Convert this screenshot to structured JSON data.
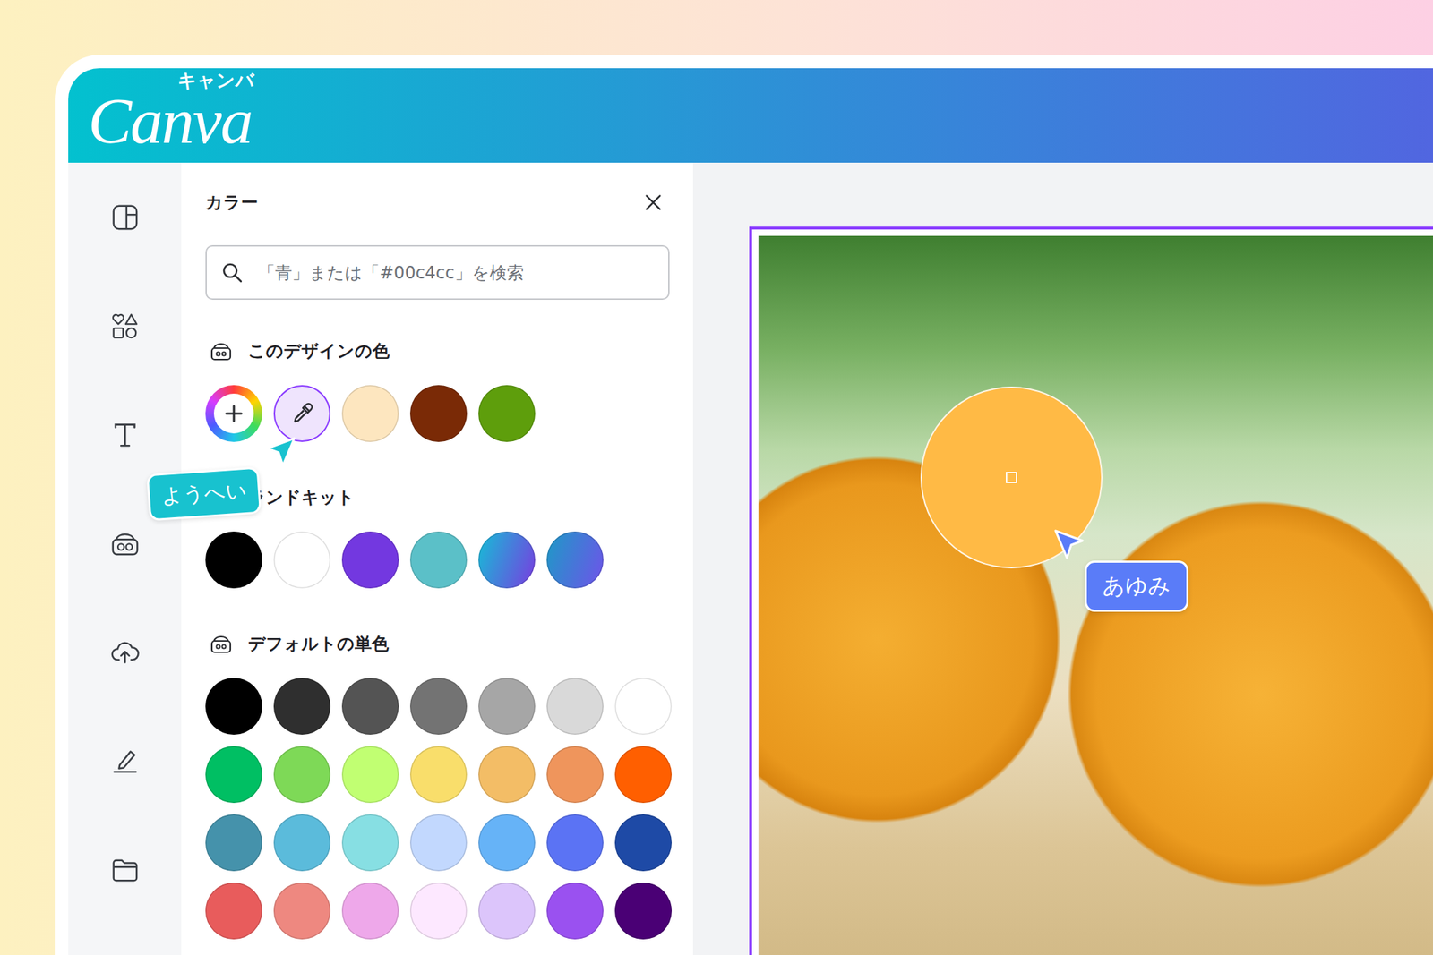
{
  "app": {
    "logo": "Canva",
    "logo_kana": "キャンバ"
  },
  "panel": {
    "title": "カラー"
  },
  "search": {
    "placeholder": "「青」または「#00c4cc」を検索"
  },
  "sections": [
    {
      "title": "このデザインの色",
      "swatches": [
        {
          "kind": "add",
          "selected": false
        },
        {
          "kind": "eyedropper",
          "selected": true
        },
        {
          "kind": "color",
          "color": "#fde6bf",
          "selected": false
        },
        {
          "kind": "color",
          "color": "#7a2a06",
          "selected": false
        },
        {
          "kind": "color",
          "color": "#5e9e0c",
          "selected": false
        }
      ]
    },
    {
      "title": "ランドキット",
      "swatches": [
        {
          "kind": "color",
          "color": "#000000",
          "selected": false
        },
        {
          "kind": "color",
          "color": "#ffffff",
          "selected": false
        },
        {
          "kind": "color",
          "color": "#7338e0",
          "selected": false
        },
        {
          "kind": "color",
          "color": "#5bc0c8",
          "selected": false
        },
        {
          "kind": "gradient",
          "color": "#14bfd6",
          "color_end": "#7a3be0",
          "selected": false
        },
        {
          "kind": "gradient",
          "color": "#1c9bc6",
          "color_end": "#7052ea",
          "selected": false
        }
      ]
    },
    {
      "title": "デフォルトの単色",
      "swatches": [
        {
          "kind": "color",
          "color": "#000000",
          "selected": false
        },
        {
          "kind": "color",
          "color": "#2f2f2f",
          "selected": false
        },
        {
          "kind": "color",
          "color": "#545454",
          "selected": false
        },
        {
          "kind": "color",
          "color": "#737373",
          "selected": false
        },
        {
          "kind": "color",
          "color": "#a6a6a6",
          "selected": false
        },
        {
          "kind": "color",
          "color": "#d9d9d9",
          "selected": false
        },
        {
          "kind": "color",
          "color": "#ffffff",
          "selected": false
        },
        {
          "kind": "color",
          "color": "#00bf63",
          "selected": false
        },
        {
          "kind": "color",
          "color": "#7ed957",
          "selected": false
        },
        {
          "kind": "color",
          "color": "#c1ff72",
          "selected": false
        },
        {
          "kind": "color",
          "color": "#f9de6b",
          "selected": false
        },
        {
          "kind": "color",
          "color": "#f3bd66",
          "selected": false
        },
        {
          "kind": "color",
          "color": "#ef955c",
          "selected": false
        },
        {
          "kind": "color",
          "color": "#ff5f00",
          "selected": false
        },
        {
          "kind": "color",
          "color": "#4592ab",
          "selected": false
        },
        {
          "kind": "color",
          "color": "#5bbbdb",
          "selected": false
        },
        {
          "kind": "color",
          "color": "#87dfe3",
          "selected": false
        },
        {
          "kind": "color",
          "color": "#c2d8fe",
          "selected": false
        },
        {
          "kind": "color",
          "color": "#66b3f7",
          "selected": false
        },
        {
          "kind": "color",
          "color": "#5b73f4",
          "selected": false
        },
        {
          "kind": "color",
          "color": "#1e4aa6",
          "selected": false
        },
        {
          "kind": "color",
          "color": "#e85c5c",
          "selected": false
        },
        {
          "kind": "color",
          "color": "#ee8880",
          "selected": false
        },
        {
          "kind": "color",
          "color": "#eea8ea",
          "selected": false
        },
        {
          "kind": "color",
          "color": "#fde8ff",
          "selected": false
        },
        {
          "kind": "color",
          "color": "#dcc5fb",
          "selected": false
        },
        {
          "kind": "color",
          "color": "#9a51f0",
          "selected": false
        },
        {
          "kind": "color",
          "color": "#4a0075",
          "selected": false
        }
      ]
    }
  ],
  "collaborators": [
    {
      "name": "ようへい",
      "color": "#18c2cf"
    },
    {
      "name": "あゆみ",
      "color": "#5a7cf8"
    }
  ]
}
